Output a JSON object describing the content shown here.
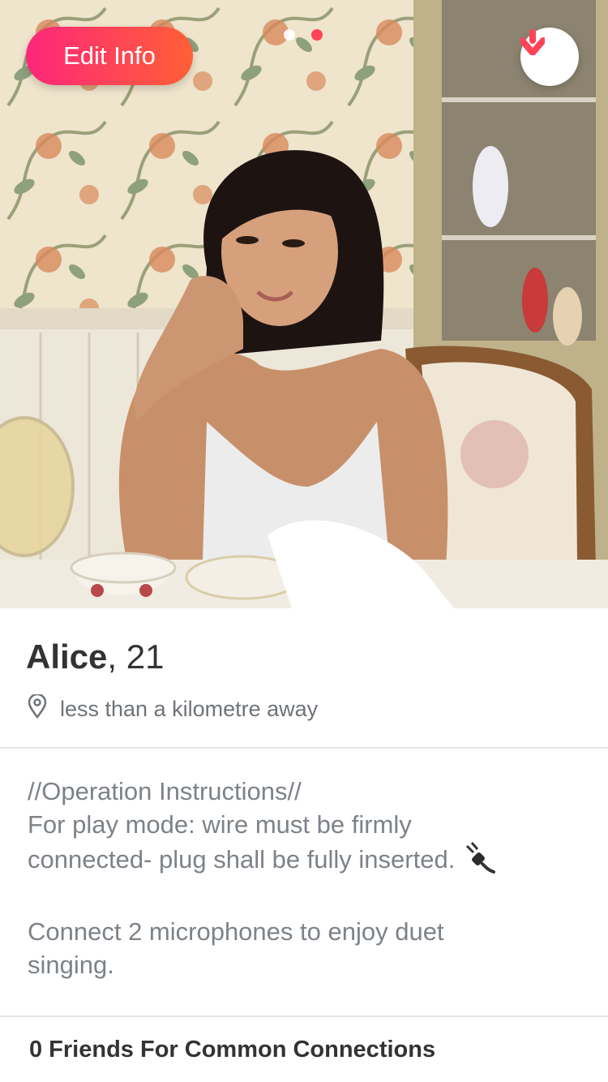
{
  "header": {
    "edit_label": "Edit Info",
    "photo_count": 2,
    "active_photo": 2
  },
  "profile": {
    "name": "Alice",
    "age": "21",
    "distance": "less than a kilometre away"
  },
  "bio": {
    "lines": [
      "//Operation Instructions//",
      "For play mode: wire must be firmly",
      "connected- plug shall be fully inserted.",
      "",
      "Connect 2 microphones to enjoy duet",
      "singing."
    ]
  },
  "connections": {
    "label": "0 Friends For Common Connections"
  },
  "colors": {
    "accent_start": "#fd267a",
    "accent_end": "#ff6036",
    "text_dark": "#333333",
    "text_muted": "#7d8288"
  },
  "icons": {
    "down": "arrow-down-icon",
    "location": "location-pin-icon",
    "bio_emoji": "plug-icon"
  }
}
